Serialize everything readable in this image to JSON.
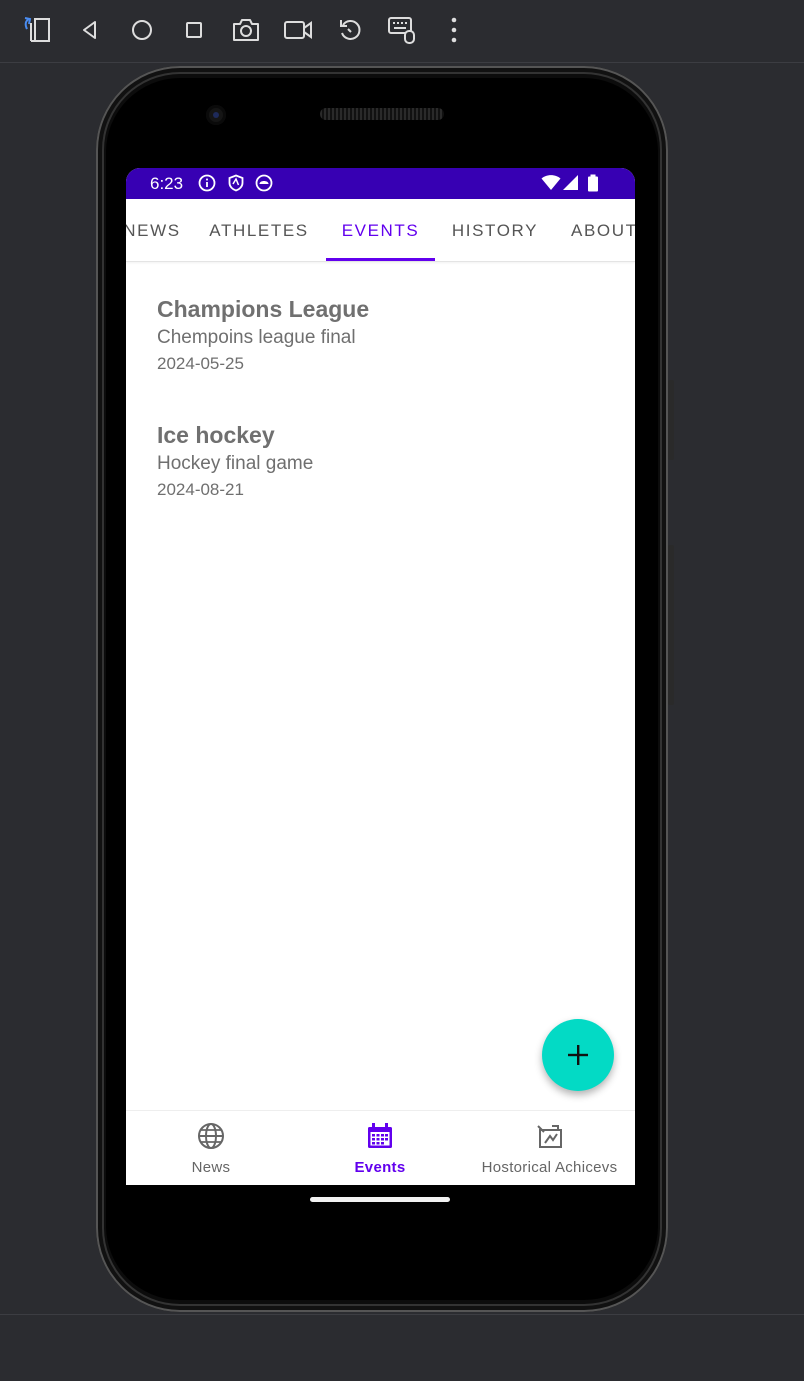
{
  "emulator_toolbar": {
    "icons": [
      "fold-icon",
      "back-icon",
      "home-icon",
      "overview-icon",
      "screenshot-icon",
      "screen-record-icon",
      "rotate-icon",
      "keyboard-mouse-icon",
      "more-icon"
    ]
  },
  "status_bar": {
    "time": "6:23",
    "icons": [
      "info-icon",
      "shield-icon",
      "sync-icon",
      "wifi-icon",
      "signal-icon",
      "battery-icon"
    ],
    "background": "#3700b3"
  },
  "tabs": [
    {
      "label": "NEWS",
      "active": false
    },
    {
      "label": "ATHLETES",
      "active": false
    },
    {
      "label": "EVENTS",
      "active": true
    },
    {
      "label": "HISTORY",
      "active": false
    },
    {
      "label": "ABOUT",
      "active": false
    }
  ],
  "events": [
    {
      "title": "Champions League",
      "description": "Chempoins league final",
      "date": "2024-05-25"
    },
    {
      "title": "Ice hockey",
      "description": "Hockey final game",
      "date": "2024-08-21"
    }
  ],
  "fab": {
    "icon": "plus-icon",
    "color": "#03dac5"
  },
  "bottom_nav": [
    {
      "label": "News",
      "icon": "globe-icon",
      "active": false
    },
    {
      "label": "Events",
      "icon": "calendar-icon",
      "active": true
    },
    {
      "label": "Hostorical Achicevs",
      "icon": "history-icon",
      "active": false
    }
  ],
  "colors": {
    "primary": "#6200ee",
    "primary_dark": "#3700b3",
    "accent": "#03dac5"
  }
}
